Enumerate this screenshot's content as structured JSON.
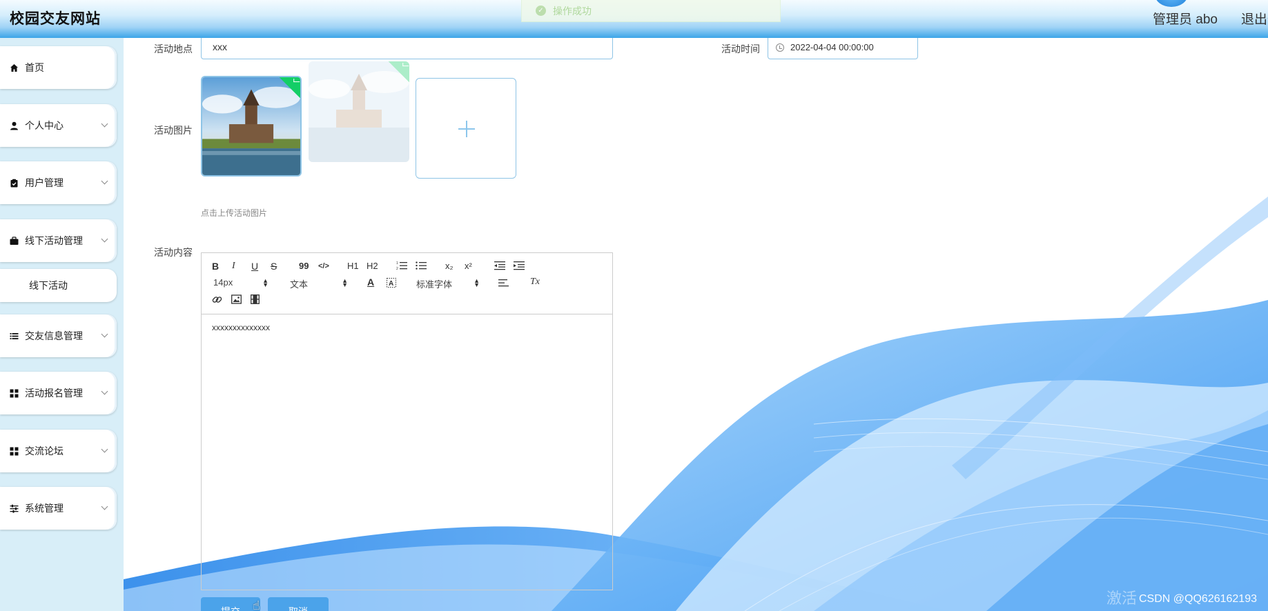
{
  "header": {
    "site_title": "校园交友网站",
    "user_label": "管理员 abo",
    "logout_label": "退出登"
  },
  "toast": {
    "message": "操作成功"
  },
  "sidebar": {
    "items": [
      {
        "label": "首页",
        "icon": "home-icon"
      },
      {
        "label": "个人中心",
        "icon": "user-icon"
      },
      {
        "label": "用户管理",
        "icon": "clipboard-icon"
      },
      {
        "label": "线下活动管理",
        "icon": "briefcase-icon"
      },
      {
        "label": "交友信息管理",
        "icon": "list-icon"
      },
      {
        "label": "活动报名管理",
        "icon": "grid-icon"
      },
      {
        "label": "交流论坛",
        "icon": "grid-icon"
      },
      {
        "label": "系统管理",
        "icon": "sliders-icon"
      }
    ],
    "subitem_label": "线下活动"
  },
  "form": {
    "location_label": "活动地点",
    "location_value": "xxx",
    "time_label": "活动时间",
    "time_value": "2022-04-04 00:00:00",
    "image_label": "活动图片",
    "upload_hint": "点击上传活动图片",
    "content_label": "活动内容",
    "content_value": "xxxxxxxxxxxxxx",
    "submit_label": "提交",
    "cancel_label": "取消"
  },
  "editor_toolbar": {
    "bold": "B",
    "italic": "I",
    "underline": "U",
    "strike": "S",
    "quote": "99",
    "code": "</>",
    "h1": "H1",
    "h2": "H2",
    "sub": "x₂",
    "sup": "x²",
    "size_value": "14px",
    "format_value": "文本",
    "font_value": "标准字体",
    "clean": "Tx"
  },
  "watermark": "CSDN @QQ626162193",
  "activate_text": "激活"
}
